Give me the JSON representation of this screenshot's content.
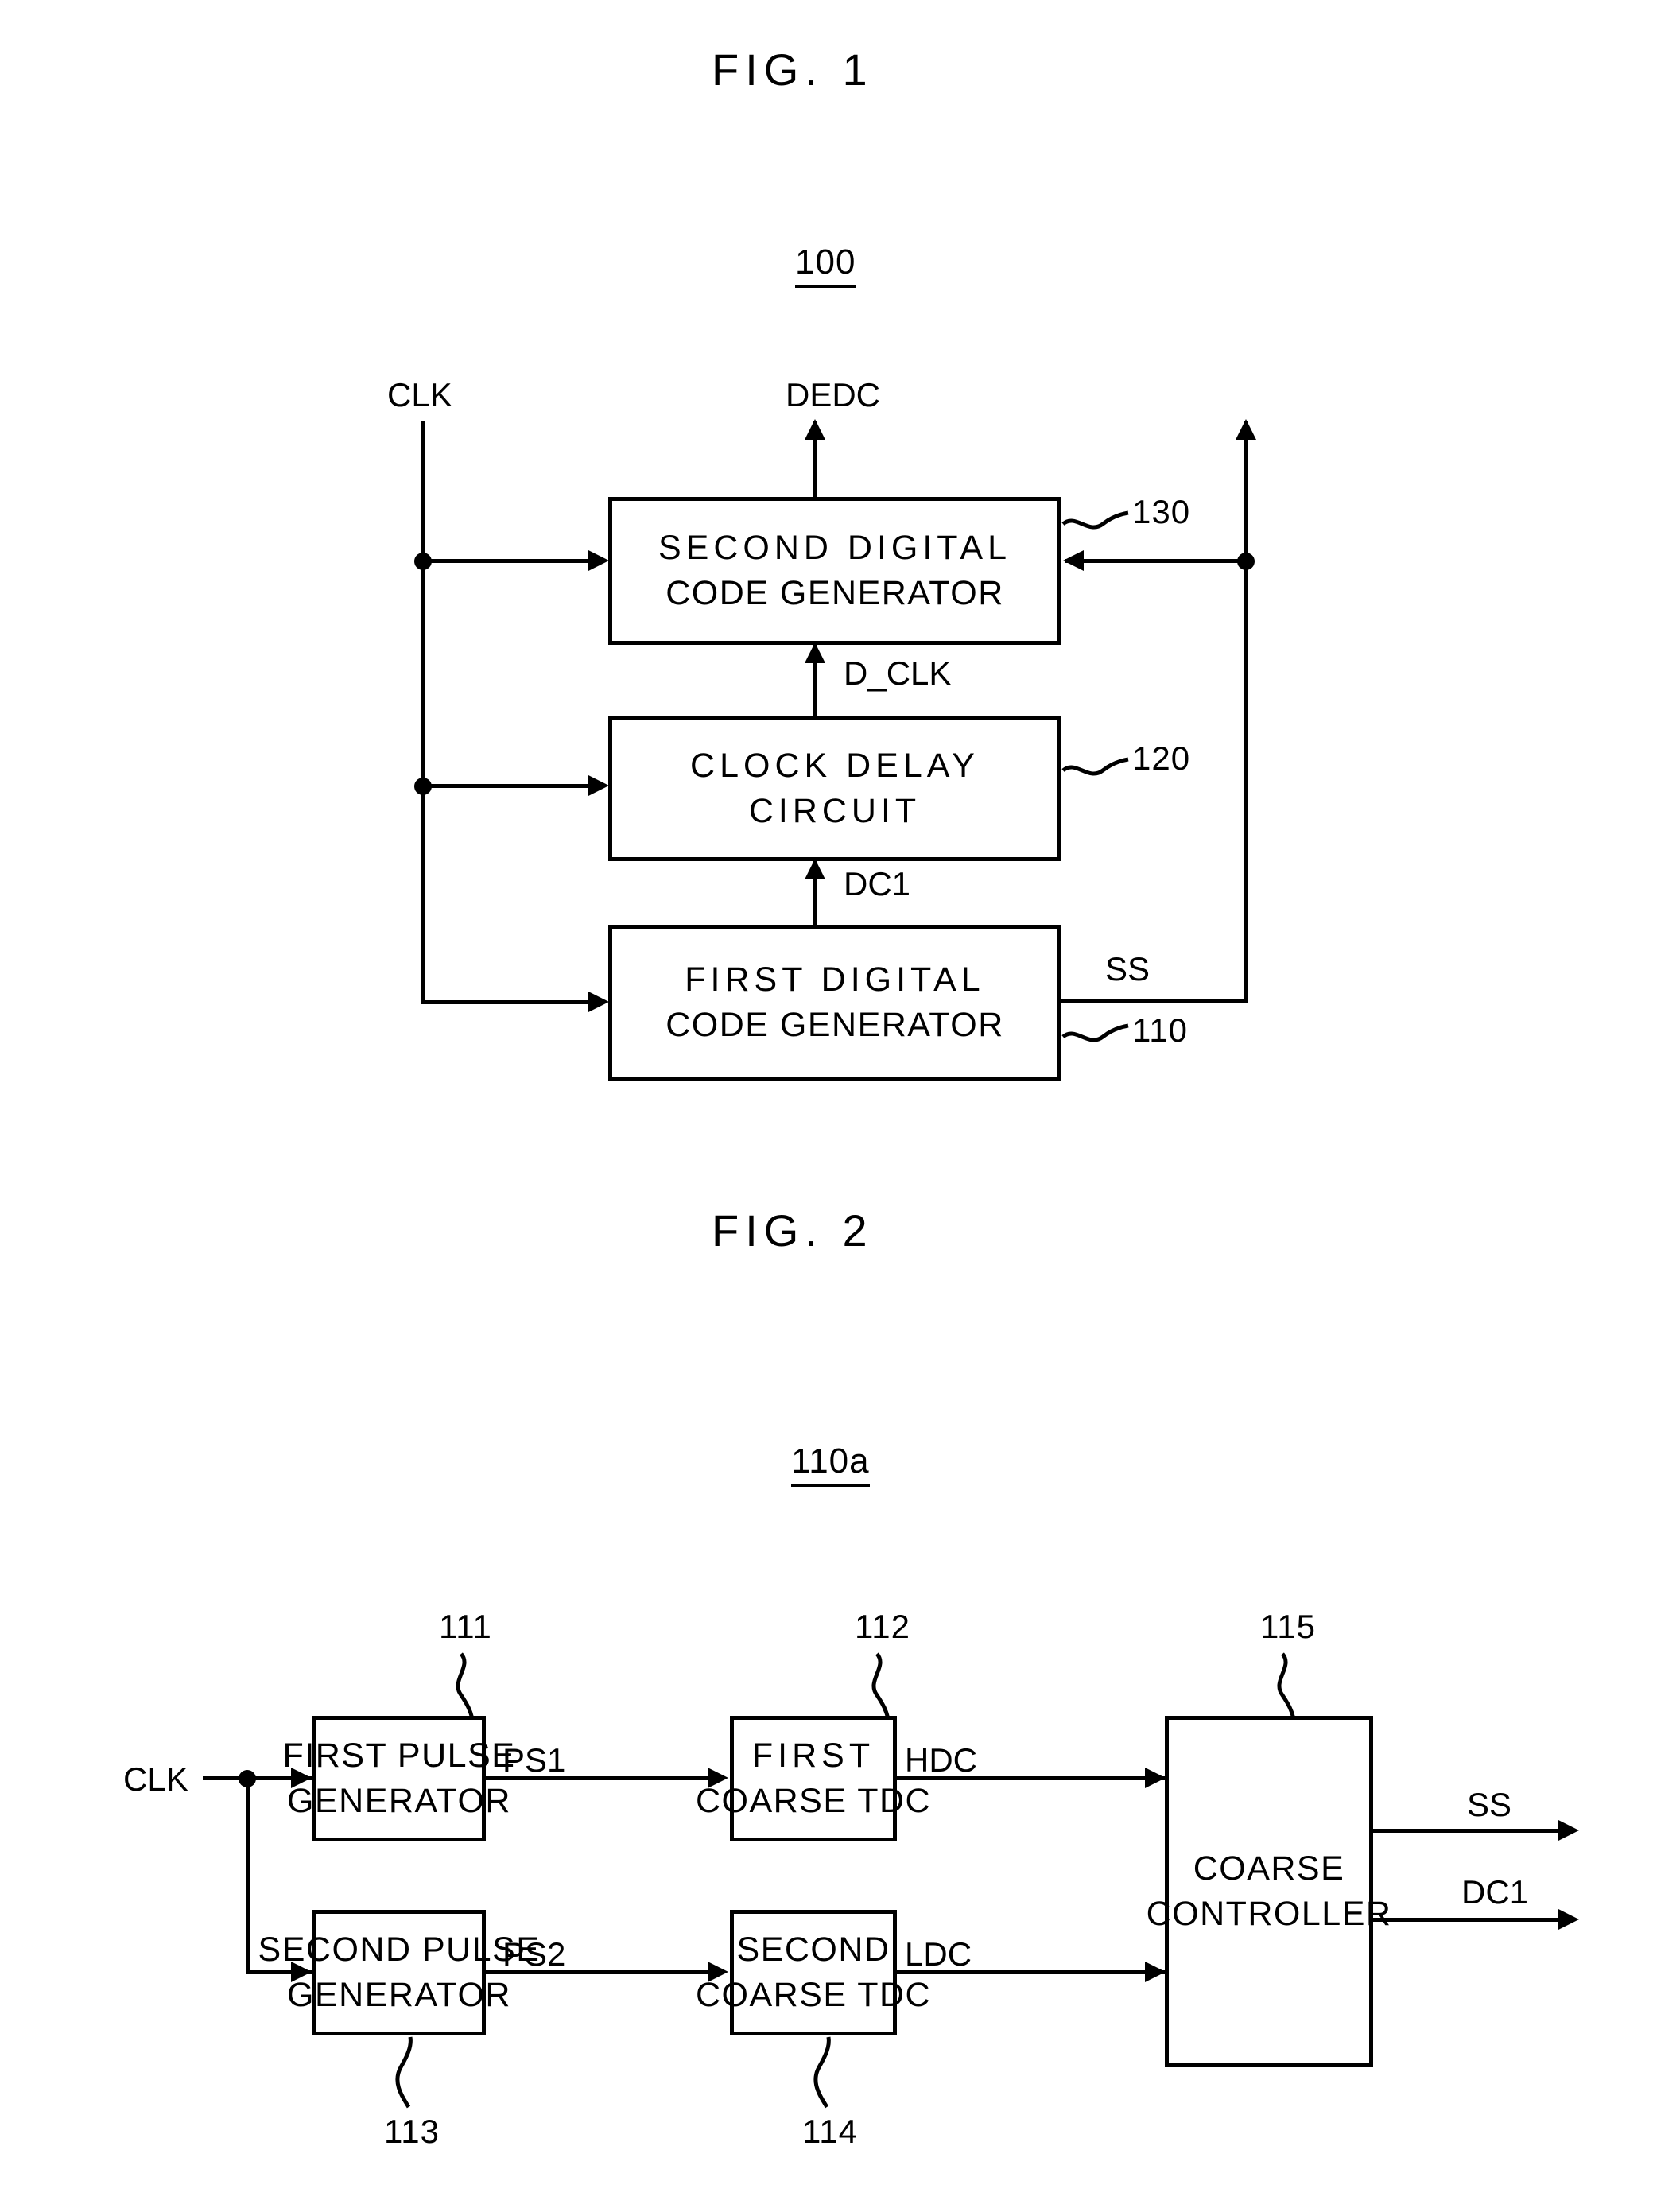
{
  "document": {
    "type": "patent-drawing-sheet"
  },
  "figures": [
    {
      "title": "FIG. 1",
      "system_ref": "100",
      "blocks": [
        {
          "ref": "130",
          "lines": [
            "SECOND DIGITAL",
            "CODE GENERATOR"
          ]
        },
        {
          "ref": "120",
          "lines": [
            "CLOCK DELAY",
            "CIRCUIT"
          ]
        },
        {
          "ref": "110",
          "lines": [
            "FIRST DIGITAL",
            "CODE GENERATOR"
          ]
        }
      ],
      "signals": [
        {
          "name": "CLK"
        },
        {
          "name": "DEDC"
        },
        {
          "name": "D_CLK"
        },
        {
          "name": "DC1"
        },
        {
          "name": "SS"
        }
      ]
    },
    {
      "title": "FIG. 2",
      "system_ref": "110a",
      "blocks": [
        {
          "ref": "111",
          "lines": [
            "FIRST PULSE",
            "GENERATOR"
          ]
        },
        {
          "ref": "112",
          "lines": [
            "FIRST",
            "COARSE TDC"
          ]
        },
        {
          "ref": "115",
          "lines": [
            "COARSE",
            "CONTROLLER"
          ]
        },
        {
          "ref": "113",
          "lines": [
            "SECOND PULSE",
            "GENERATOR"
          ]
        },
        {
          "ref": "114",
          "lines": [
            "SECOND",
            "COARSE TDC"
          ]
        }
      ],
      "signals": [
        {
          "name": "CLK"
        },
        {
          "name": "PS1"
        },
        {
          "name": "HDC"
        },
        {
          "name": "PS2"
        },
        {
          "name": "LDC"
        },
        {
          "name": "SS"
        },
        {
          "name": "DC1"
        }
      ]
    }
  ]
}
